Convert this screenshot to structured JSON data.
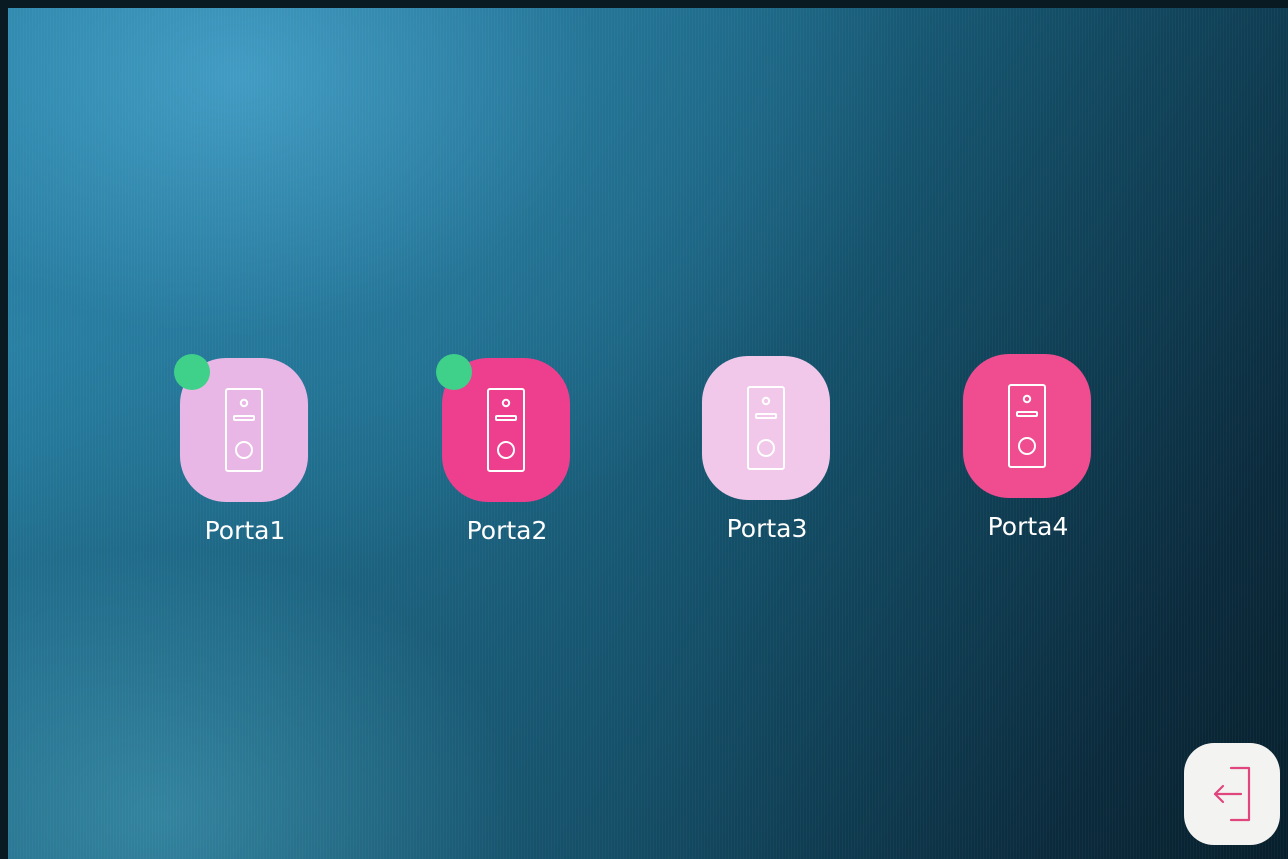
{
  "doors": [
    {
      "label": "Porta1",
      "icon": "doorbell-icon",
      "tile_color": "#e9b7e6",
      "online": true
    },
    {
      "label": "Porta2",
      "icon": "doorbell-icon",
      "tile_color": "#ee3f8e",
      "online": true
    },
    {
      "label": "Porta3",
      "icon": "doorbell-icon",
      "tile_color": "#f1c8e9",
      "online": false
    },
    {
      "label": "Porta4",
      "icon": "doorbell-icon",
      "tile_color": "#f04c90",
      "online": false
    }
  ],
  "status_dot_color": "#3fd08a",
  "exit_button": {
    "icon": "exit-icon",
    "icon_color": "#e0457e",
    "background": "#f3f4f2"
  }
}
